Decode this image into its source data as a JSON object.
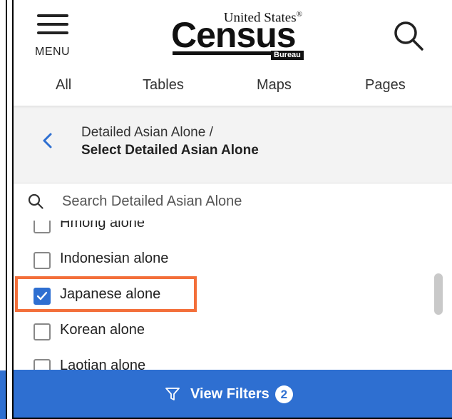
{
  "header": {
    "menu_label": "MENU",
    "logo": {
      "top": "United States",
      "registered": "®",
      "main": "Census",
      "sub": "Bureau"
    },
    "icons": {
      "menu": "hamburger-icon",
      "search": "search-icon"
    }
  },
  "tabs": [
    {
      "label": "All"
    },
    {
      "label": "Tables"
    },
    {
      "label": "Maps"
    },
    {
      "label": "Pages"
    }
  ],
  "breadcrumb": {
    "parent": "Detailed Asian Alone /",
    "current": "Select Detailed Asian Alone",
    "back_icon": "chevron-left-icon"
  },
  "search": {
    "placeholder": "Search Detailed Asian Alone",
    "value": ""
  },
  "list": {
    "items": [
      {
        "label": "Hmong alone",
        "checked": false
      },
      {
        "label": "Indonesian alone",
        "checked": false
      },
      {
        "label": "Japanese alone",
        "checked": true
      },
      {
        "label": "Korean alone",
        "checked": false
      },
      {
        "label": "Laotian alone",
        "checked": false
      }
    ]
  },
  "footer": {
    "view_filters_label": "View Filters",
    "filter_count": "2",
    "icon": "filter-funnel-icon"
  },
  "colors": {
    "accent": "#2e6fd1",
    "highlight": "#f36f3a",
    "breadcrumb_bg": "#f3f3f3"
  }
}
